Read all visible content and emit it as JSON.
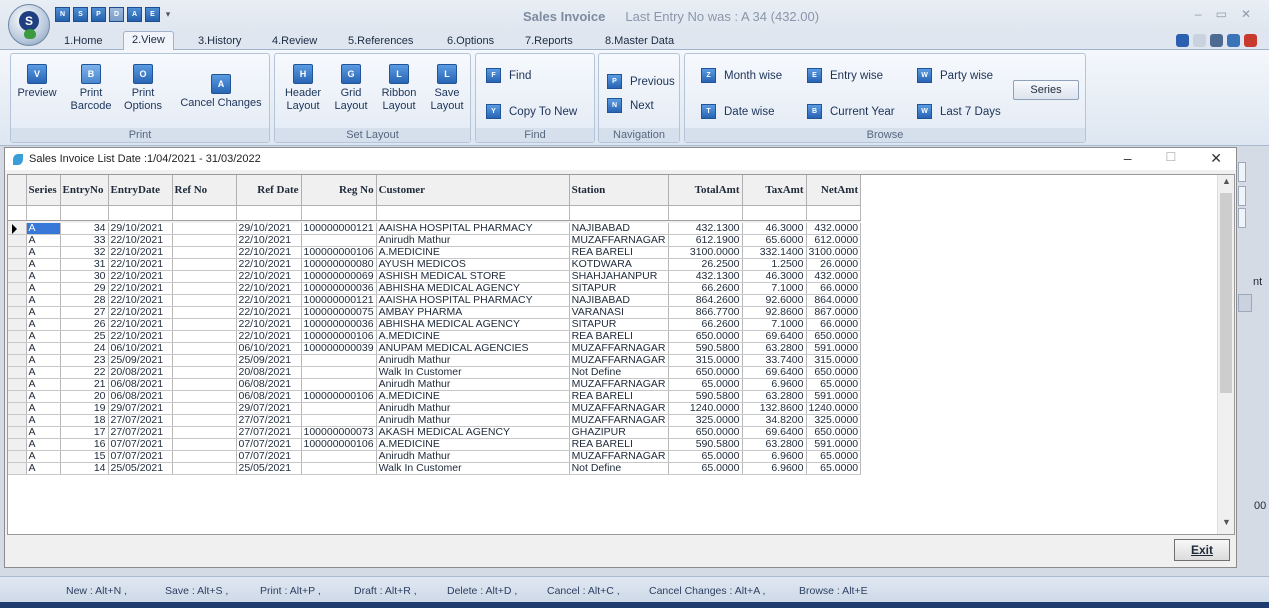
{
  "window": {
    "title": "Sales Invoice",
    "subtitle": "Last Entry No was : A 34   (432.00)"
  },
  "qat": [
    "N",
    "S",
    "P",
    "D",
    "A",
    "E"
  ],
  "tabs": [
    {
      "label": "1.Home"
    },
    {
      "label": "2.View"
    },
    {
      "label": "3.History"
    },
    {
      "label": "4.Review"
    },
    {
      "label": "5.References"
    },
    {
      "label": "6.Options"
    },
    {
      "label": "7.Reports"
    },
    {
      "label": "8.Master Data"
    }
  ],
  "active_tab": "2.View",
  "ribbon": {
    "print_group": {
      "label": "Print",
      "preview": "Preview",
      "print_barcode_1": "Print",
      "print_barcode_2": "Barcode",
      "print_options_1": "Print",
      "print_options_2": "Options",
      "cancel_changes": "Cancel Changes"
    },
    "set_layout_group": {
      "label": "Set Layout",
      "header_1": "Header",
      "header_2": "Layout",
      "grid_1": "Grid",
      "grid_2": "Layout",
      "ribbon_1": "Ribbon",
      "ribbon_2": "Layout",
      "save_1": "Save",
      "save_2": "Layout"
    },
    "find_group": {
      "label": "Find",
      "find": "Find",
      "copy_to_new": "Copy To New"
    },
    "navigation_group": {
      "label": "Navigation",
      "previous": "Previous",
      "next": "Next"
    },
    "browse_group": {
      "label": "Browse",
      "month_wise": "Month wise",
      "entry_wise": "Entry wise",
      "party_wise": "Party wise",
      "date_wise": "Date wise",
      "current_year": "Current Year",
      "last_7_days": "Last 7 Days",
      "series": "Series"
    }
  },
  "list_window": {
    "title": "Sales Invoice List  Date :1/04/2021 - 31/03/2022",
    "exit_label": "Exit"
  },
  "table": {
    "columns": [
      "Series",
      "EntryNo",
      "EntryDate",
      "Ref No",
      "Ref Date",
      "Reg No",
      "Customer",
      "Station",
      "TotalAmt",
      "TaxAmt",
      "NetAmt"
    ],
    "rows": [
      [
        "A",
        "34",
        "29/10/2021",
        "",
        "29/10/2021",
        "100000000121",
        "AAISHA HOSPITAL PHARMACY",
        "NAJIBABAD",
        "432.1300",
        "46.3000",
        "432.0000"
      ],
      [
        "A",
        "33",
        "22/10/2021",
        "",
        "22/10/2021",
        "",
        "Anirudh Mathur",
        "MUZAFFARNAGAR",
        "612.1900",
        "65.6000",
        "612.0000"
      ],
      [
        "A",
        "32",
        "22/10/2021",
        "",
        "22/10/2021",
        "100000000106",
        "A.MEDICINE",
        "REA BARELI",
        "3100.0000",
        "332.1400",
        "3100.0000"
      ],
      [
        "A",
        "31",
        "22/10/2021",
        "",
        "22/10/2021",
        "100000000080",
        "AYUSH MEDICOS",
        "KOTDWARA",
        "26.2500",
        "1.2500",
        "26.0000"
      ],
      [
        "A",
        "30",
        "22/10/2021",
        "",
        "22/10/2021",
        "100000000069",
        "ASHISH MEDICAL STORE",
        "SHAHJAHANPUR",
        "432.1300",
        "46.3000",
        "432.0000"
      ],
      [
        "A",
        "29",
        "22/10/2021",
        "",
        "22/10/2021",
        "100000000036",
        "ABHISHA MEDICAL AGENCY",
        "SITAPUR",
        "66.2600",
        "7.1000",
        "66.0000"
      ],
      [
        "A",
        "28",
        "22/10/2021",
        "",
        "22/10/2021",
        "100000000121",
        "AAISHA HOSPITAL PHARMACY",
        "NAJIBABAD",
        "864.2600",
        "92.6000",
        "864.0000"
      ],
      [
        "A",
        "27",
        "22/10/2021",
        "",
        "22/10/2021",
        "100000000075",
        "AMBAY PHARMA",
        "VARANASI",
        "866.7700",
        "92.8600",
        "867.0000"
      ],
      [
        "A",
        "26",
        "22/10/2021",
        "",
        "22/10/2021",
        "100000000036",
        "ABHISHA MEDICAL AGENCY",
        "SITAPUR",
        "66.2600",
        "7.1000",
        "66.0000"
      ],
      [
        "A",
        "25",
        "22/10/2021",
        "",
        "22/10/2021",
        "100000000106",
        "A.MEDICINE",
        "REA BARELI",
        "650.0000",
        "69.6400",
        "650.0000"
      ],
      [
        "A",
        "24",
        "06/10/2021",
        "",
        "06/10/2021",
        "100000000039",
        "ANUPAM MEDICAL AGENCIES",
        "MUZAFFARNAGAR",
        "590.5800",
        "63.2800",
        "591.0000"
      ],
      [
        "A",
        "23",
        "25/09/2021",
        "",
        "25/09/2021",
        "",
        "Anirudh Mathur",
        "MUZAFFARNAGAR",
        "315.0000",
        "33.7400",
        "315.0000"
      ],
      [
        "A",
        "22",
        "20/08/2021",
        "",
        "20/08/2021",
        "",
        "Walk In Customer",
        "Not Define",
        "650.0000",
        "69.6400",
        "650.0000"
      ],
      [
        "A",
        "21",
        "06/08/2021",
        "",
        "06/08/2021",
        "",
        "Anirudh Mathur",
        "MUZAFFARNAGAR",
        "65.0000",
        "6.9600",
        "65.0000"
      ],
      [
        "A",
        "20",
        "06/08/2021",
        "",
        "06/08/2021",
        "100000000106",
        "A.MEDICINE",
        "REA BARELI",
        "590.5800",
        "63.2800",
        "591.0000"
      ],
      [
        "A",
        "19",
        "29/07/2021",
        "",
        "29/07/2021",
        "",
        "Anirudh Mathur",
        "MUZAFFARNAGAR",
        "1240.0000",
        "132.8600",
        "1240.0000"
      ],
      [
        "A",
        "18",
        "27/07/2021",
        "",
        "27/07/2021",
        "",
        "Anirudh Mathur",
        "MUZAFFARNAGAR",
        "325.0000",
        "34.8200",
        "325.0000"
      ],
      [
        "A",
        "17",
        "27/07/2021",
        "",
        "27/07/2021",
        "100000000073",
        "AKASH MEDICAL AGENCY",
        "GHAZIPUR",
        "650.0000",
        "69.6400",
        "650.0000"
      ],
      [
        "A",
        "16",
        "07/07/2021",
        "",
        "07/07/2021",
        "100000000106",
        "A.MEDICINE",
        "REA BARELI",
        "590.5800",
        "63.2800",
        "591.0000"
      ],
      [
        "A",
        "15",
        "07/07/2021",
        "",
        "07/07/2021",
        "",
        "Anirudh Mathur",
        "MUZAFFARNAGAR",
        "65.0000",
        "6.9600",
        "65.0000"
      ],
      [
        "A",
        "14",
        "25/05/2021",
        "",
        "25/05/2021",
        "",
        "Walk In Customer",
        "Not Define",
        "65.0000",
        "6.9600",
        "65.0000"
      ]
    ]
  },
  "peek": {
    "nt": "nt",
    "zero": "00"
  },
  "statusbar": [
    "New : Alt+N ,",
    "Save : Alt+S ,",
    "Print : Alt+P ,",
    "Draft : Alt+R ,",
    "Delete : Alt+D ,",
    "Cancel : Alt+C ,",
    "Cancel Changes : Alt+A ,",
    "Browse : Alt+E"
  ],
  "colors": {
    "selection": "#3878d8",
    "ribbon_icon": "#2864b3",
    "bottom_strip": "#1f3c6e"
  }
}
